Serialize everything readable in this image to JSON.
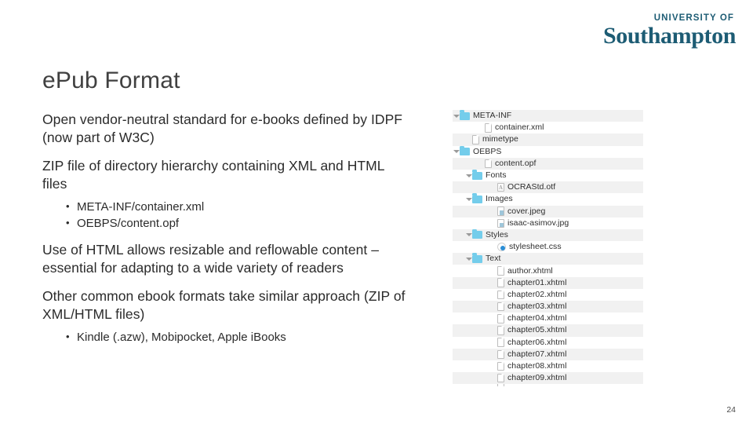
{
  "logo": {
    "university_line": "UNIVERSITY OF",
    "name_line": "Southampton",
    "brand_color": "#1d5c74"
  },
  "slide": {
    "title": "ePub Format",
    "page_number": "24"
  },
  "body": {
    "paragraphs": [
      "Open vendor-neutral standard for e-books defined by IDPF (now part of W3C)",
      "ZIP file of directory hierarchy containing XML and HTML files",
      "Use of HTML allows resizable and reflowable content – essential for adapting to a wide variety of readers",
      "Other common ebook formats take similar approach (ZIP of XML/HTML files)"
    ],
    "sublist_a": [
      "META-INF/container.xml",
      "OEBPS/content.opf"
    ],
    "sublist_b": [
      "Kindle (.azw), Mobipocket, Apple iBooks"
    ],
    "bullet_glyph": "•"
  },
  "file_tree": {
    "folder_color": "#74cdeb",
    "stripe_color": "#f1f1f1",
    "rows": [
      {
        "label": "META-INF",
        "icon": "folder-icon",
        "indent": 0,
        "disclosure": "open",
        "stripe": true
      },
      {
        "label": "container.xml",
        "icon": "document-icon",
        "indent": 2,
        "disclosure": "none",
        "stripe": false
      },
      {
        "label": "mimetype",
        "icon": "document-icon",
        "indent": 1,
        "disclosure": "none",
        "stripe": true
      },
      {
        "label": "OEBPS",
        "icon": "folder-icon",
        "indent": 0,
        "disclosure": "open",
        "stripe": false
      },
      {
        "label": "content.opf",
        "icon": "document-icon",
        "indent": 2,
        "disclosure": "none",
        "stripe": true
      },
      {
        "label": "Fonts",
        "icon": "folder-icon",
        "indent": 1,
        "disclosure": "open",
        "stripe": false
      },
      {
        "label": "OCRAStd.otf",
        "icon": "font-icon",
        "indent": 3,
        "disclosure": "none",
        "stripe": true
      },
      {
        "label": "Images",
        "icon": "folder-icon",
        "indent": 1,
        "disclosure": "open",
        "stripe": false
      },
      {
        "label": "cover.jpeg",
        "icon": "image-icon",
        "indent": 3,
        "disclosure": "none",
        "stripe": true
      },
      {
        "label": "isaac-asimov.jpg",
        "icon": "image-icon",
        "indent": 3,
        "disclosure": "none",
        "stripe": false
      },
      {
        "label": "Styles",
        "icon": "folder-icon",
        "indent": 1,
        "disclosure": "open",
        "stripe": true
      },
      {
        "label": "stylesheet.css",
        "icon": "css-icon",
        "indent": 3,
        "disclosure": "none",
        "stripe": false
      },
      {
        "label": "Text",
        "icon": "folder-icon",
        "indent": 1,
        "disclosure": "open",
        "stripe": true
      },
      {
        "label": "author.xhtml",
        "icon": "document-icon",
        "indent": 3,
        "disclosure": "none",
        "stripe": false
      },
      {
        "label": "chapter01.xhtml",
        "icon": "document-icon",
        "indent": 3,
        "disclosure": "none",
        "stripe": true
      },
      {
        "label": "chapter02.xhtml",
        "icon": "document-icon",
        "indent": 3,
        "disclosure": "none",
        "stripe": false
      },
      {
        "label": "chapter03.xhtml",
        "icon": "document-icon",
        "indent": 3,
        "disclosure": "none",
        "stripe": true
      },
      {
        "label": "chapter04.xhtml",
        "icon": "document-icon",
        "indent": 3,
        "disclosure": "none",
        "stripe": false
      },
      {
        "label": "chapter05.xhtml",
        "icon": "document-icon",
        "indent": 3,
        "disclosure": "none",
        "stripe": true
      },
      {
        "label": "chapter06.xhtml",
        "icon": "document-icon",
        "indent": 3,
        "disclosure": "none",
        "stripe": false
      },
      {
        "label": "chapter07.xhtml",
        "icon": "document-icon",
        "indent": 3,
        "disclosure": "none",
        "stripe": true
      },
      {
        "label": "chapter08.xhtml",
        "icon": "document-icon",
        "indent": 3,
        "disclosure": "none",
        "stripe": false
      },
      {
        "label": "chapter09.xhtml",
        "icon": "document-icon",
        "indent": 3,
        "disclosure": "none",
        "stripe": true
      },
      {
        "label": "",
        "icon": "document-icon",
        "indent": 3,
        "disclosure": "none",
        "stripe": false,
        "clipped": true
      }
    ]
  }
}
